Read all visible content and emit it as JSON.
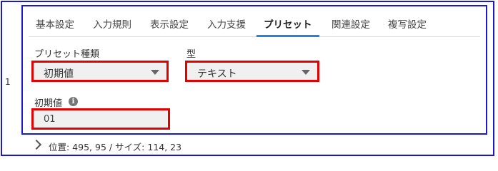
{
  "row": {
    "number": "1"
  },
  "tabs": [
    {
      "label": "基本設定",
      "active": false
    },
    {
      "label": "入力規則",
      "active": false
    },
    {
      "label": "表示設定",
      "active": false
    },
    {
      "label": "入力支援",
      "active": false
    },
    {
      "label": "プリセット",
      "active": true
    },
    {
      "label": "関連設定",
      "active": false
    },
    {
      "label": "複写設定",
      "active": false
    }
  ],
  "preset": {
    "type_label": "プリセット種類",
    "type_value": "初期値",
    "kind_label": "型",
    "kind_value": "テキスト",
    "initial_label": "初期値",
    "initial_value": "01"
  },
  "footer": {
    "text": "位置: 495, 95 / サイズ: 114, 23"
  },
  "colors": {
    "highlight_border": "#e20000",
    "frame_border": "#1a1acc",
    "active_tab_underline": "#2c80d8"
  }
}
